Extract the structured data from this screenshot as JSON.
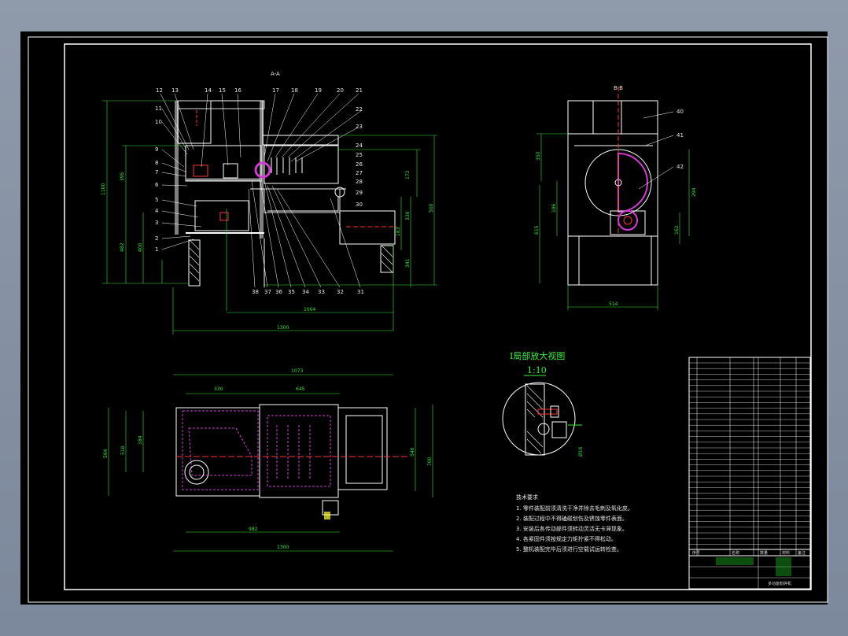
{
  "section_labels": {
    "front": "A-A",
    "side": "B-B"
  },
  "part_numbers_top": [
    "12",
    "13",
    "14",
    "15",
    "16",
    "17",
    "18",
    "19",
    "20",
    "21"
  ],
  "part_numbers_right": [
    "22",
    "23",
    "24",
    "25",
    "26",
    "27",
    "28",
    "29",
    "30"
  ],
  "part_numbers_left": [
    "11",
    "10",
    "9",
    "8",
    "7",
    "6",
    "5",
    "4",
    "3",
    "2",
    "1"
  ],
  "part_numbers_bottom": [
    "38",
    "37",
    "36",
    "35",
    "34",
    "33",
    "32",
    "31"
  ],
  "side_view_tags": [
    "40",
    "41",
    "42"
  ],
  "dims_front": {
    "d1": "1100",
    "d2": "395",
    "d3": "482",
    "d4": "400",
    "d5": "172",
    "d6": "330",
    "d7": "183",
    "d8": "341",
    "d9": "500",
    "d10": "1004",
    "d11": "1300"
  },
  "dims_side": {
    "d1": "350",
    "d2": "186",
    "d3": "615",
    "d4": "294",
    "d5": "162",
    "d6": "514"
  },
  "dims_plan": {
    "d1": "1073",
    "d2": "330",
    "d3": "645",
    "d4": "184",
    "d5": "518",
    "d6": "564",
    "d7": "546",
    "d8": "700",
    "d9": "982",
    "d10": "1300"
  },
  "detail": {
    "title": "I局部放大视图",
    "scale": "1:10",
    "dim": "Ø16"
  },
  "notes": {
    "title": "技术要求",
    "items": [
      "1. 零件装配前须清洗干净并除去毛刺及氧化皮。",
      "2. 装配过程中不得磕碰划伤及锈蚀零件表面。",
      "3. 安装后各传动部件须转动灵活无卡滞现象。",
      "4. 各紧固件须按规定力矩拧紧不得松动。",
      "5. 整机装配完毕后须进行空载试运转检查。"
    ]
  },
  "title_block": {
    "drawing_name": "多功能粉碎机",
    "headers": [
      "序号",
      "名称",
      "数量",
      "材料",
      "备注"
    ]
  },
  "colors": {
    "line": "#ffffff",
    "dim": "#33e833",
    "hidden": "#d23cd2",
    "center": "#ff3333",
    "accent": "#ffff33"
  }
}
